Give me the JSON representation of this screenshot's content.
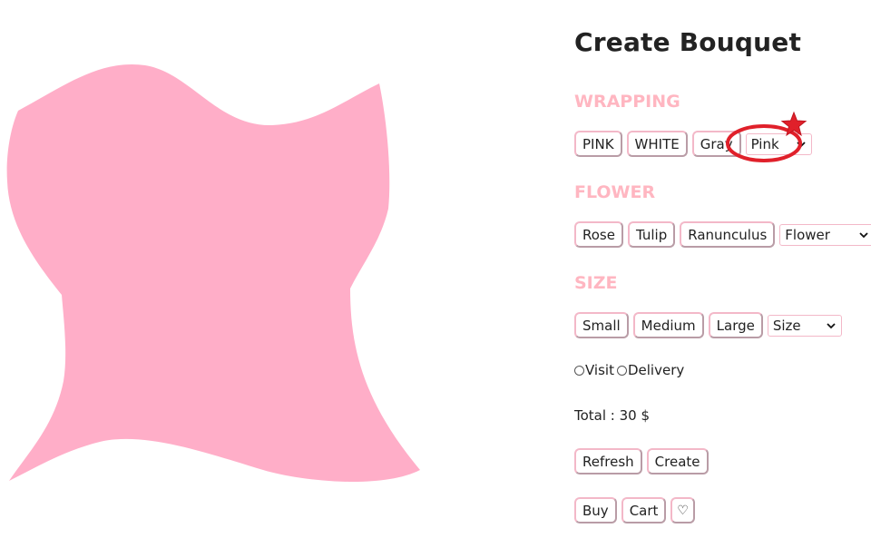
{
  "title": "Create Bouquet",
  "colors": {
    "accent": "#ffb6c1",
    "bouquet_fill": "#ffaec8",
    "button_border": "#f3b8c8",
    "annotation_red": "#e0202a"
  },
  "wrapping": {
    "label": "WRAPPING",
    "options": [
      "PINK",
      "WHITE",
      "Gray"
    ],
    "select_value": "Pink"
  },
  "flower": {
    "label": "FLOWER",
    "options": [
      "Rose",
      "Tulip",
      "Ranunculus"
    ],
    "select_value": "Flower"
  },
  "size": {
    "label": "SIZE",
    "options": [
      "Small",
      "Medium",
      "Large"
    ],
    "select_value": "Size"
  },
  "receive": {
    "options": [
      "Visit",
      "Delivery"
    ]
  },
  "total": {
    "text": "Total : 30 $"
  },
  "actions": {
    "refresh": "Refresh",
    "create": "Create",
    "buy": "Buy",
    "cart": "Cart",
    "wishlist": "♡"
  },
  "annotation": {
    "shape": "circle-with-star",
    "target": "wrapping-select"
  }
}
